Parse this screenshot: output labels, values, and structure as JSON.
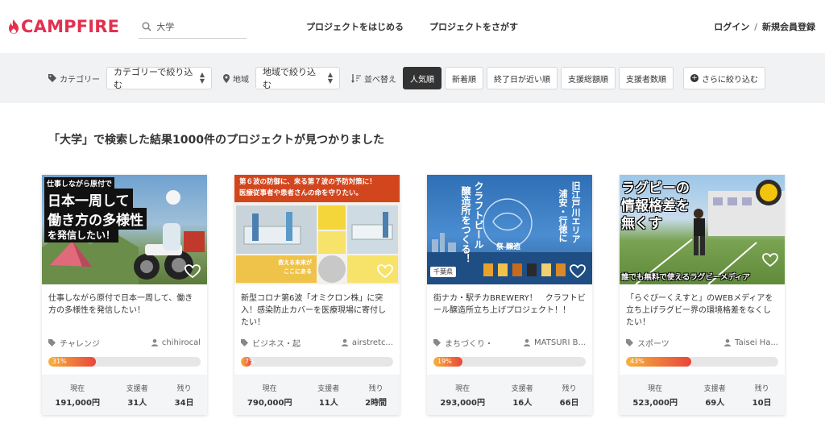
{
  "header": {
    "logo": "CAMPFIRE",
    "search_value": "大学",
    "nav": [
      "プロジェクトをはじめる",
      "プロジェクトをさがす"
    ],
    "login": "ログイン",
    "separator": "/",
    "signup": "新規会員登録"
  },
  "filters": {
    "category_label": "カテゴリー",
    "category_select": "カテゴリーで絞り込む",
    "area_label": "地域",
    "area_select": "地域で絞り込む",
    "sort_label": "並べ替え",
    "sort_options": [
      "人気順",
      "新着順",
      "終了日が近い順",
      "支援総額順",
      "支援者数順"
    ],
    "active_sort": "人気順",
    "more": "さらに絞り込む"
  },
  "result_title": "「大学」で検索した結果1000件のプロジェクトが見つかりました",
  "stat_labels": {
    "current": "現在",
    "supporters": "支援者",
    "remaining": "残り"
  },
  "cards": [
    {
      "thumb_text": [
        "仕事しながら原付で",
        "日本一周して",
        "働き方の多様性",
        "を発信したい！"
      ],
      "title": "仕事しながら原付で日本一周して、働き方の多様性を発信したい！",
      "tag": "チャレンジ",
      "user": "chihirocal",
      "progress_label": "31%",
      "progress": 0.31,
      "current": "191,000円",
      "supporters": "31人",
      "remaining": "34日"
    },
    {
      "thumb_text": [
        "第６波の防御に、来る第７波の予防対策に！",
        "医療従事者や患者さんの命を守りたい。",
        "救える未来が",
        "ここにある"
      ],
      "title": "新型コロナ第6波「オミクロン株」に突入！感染防止カバーを医療現場に寄付したい！",
      "tag": "ビジネス・起",
      "user": "airstretc...",
      "progress_label": "7%",
      "progress": 0.07,
      "current": "790,000円",
      "supporters": "11人",
      "remaining": "2時間"
    },
    {
      "thumb_text": [
        "クラフトビール",
        "醸造所をつくる！",
        "旧江戸川エリア",
        "浦安・行徳に",
        "祭 醸造",
        "千葉県"
      ],
      "title": "街ナカ・駅チカBREWERY！　クラフトビール醸造所立ち上げプロジェクト！！",
      "tag": "まちづくり・",
      "user": "MATSURI B...",
      "progress_label": "19%",
      "progress": 0.19,
      "current": "293,000円",
      "supporters": "16人",
      "remaining": "66日"
    },
    {
      "thumb_text": [
        "ラグビーの",
        "情報格差を",
        "無くす",
        "誰でも無料で使えるラグビーメディア"
      ],
      "title": "「らぐびーくえすと」のWEBメディアを立ち上げラグビー界の環境格差をなくしたい！",
      "tag": "スポーツ",
      "user": "Taisei Ha...",
      "progress_label": "43%",
      "progress": 0.43,
      "current": "523,000円",
      "supporters": "69人",
      "remaining": "10日"
    }
  ]
}
